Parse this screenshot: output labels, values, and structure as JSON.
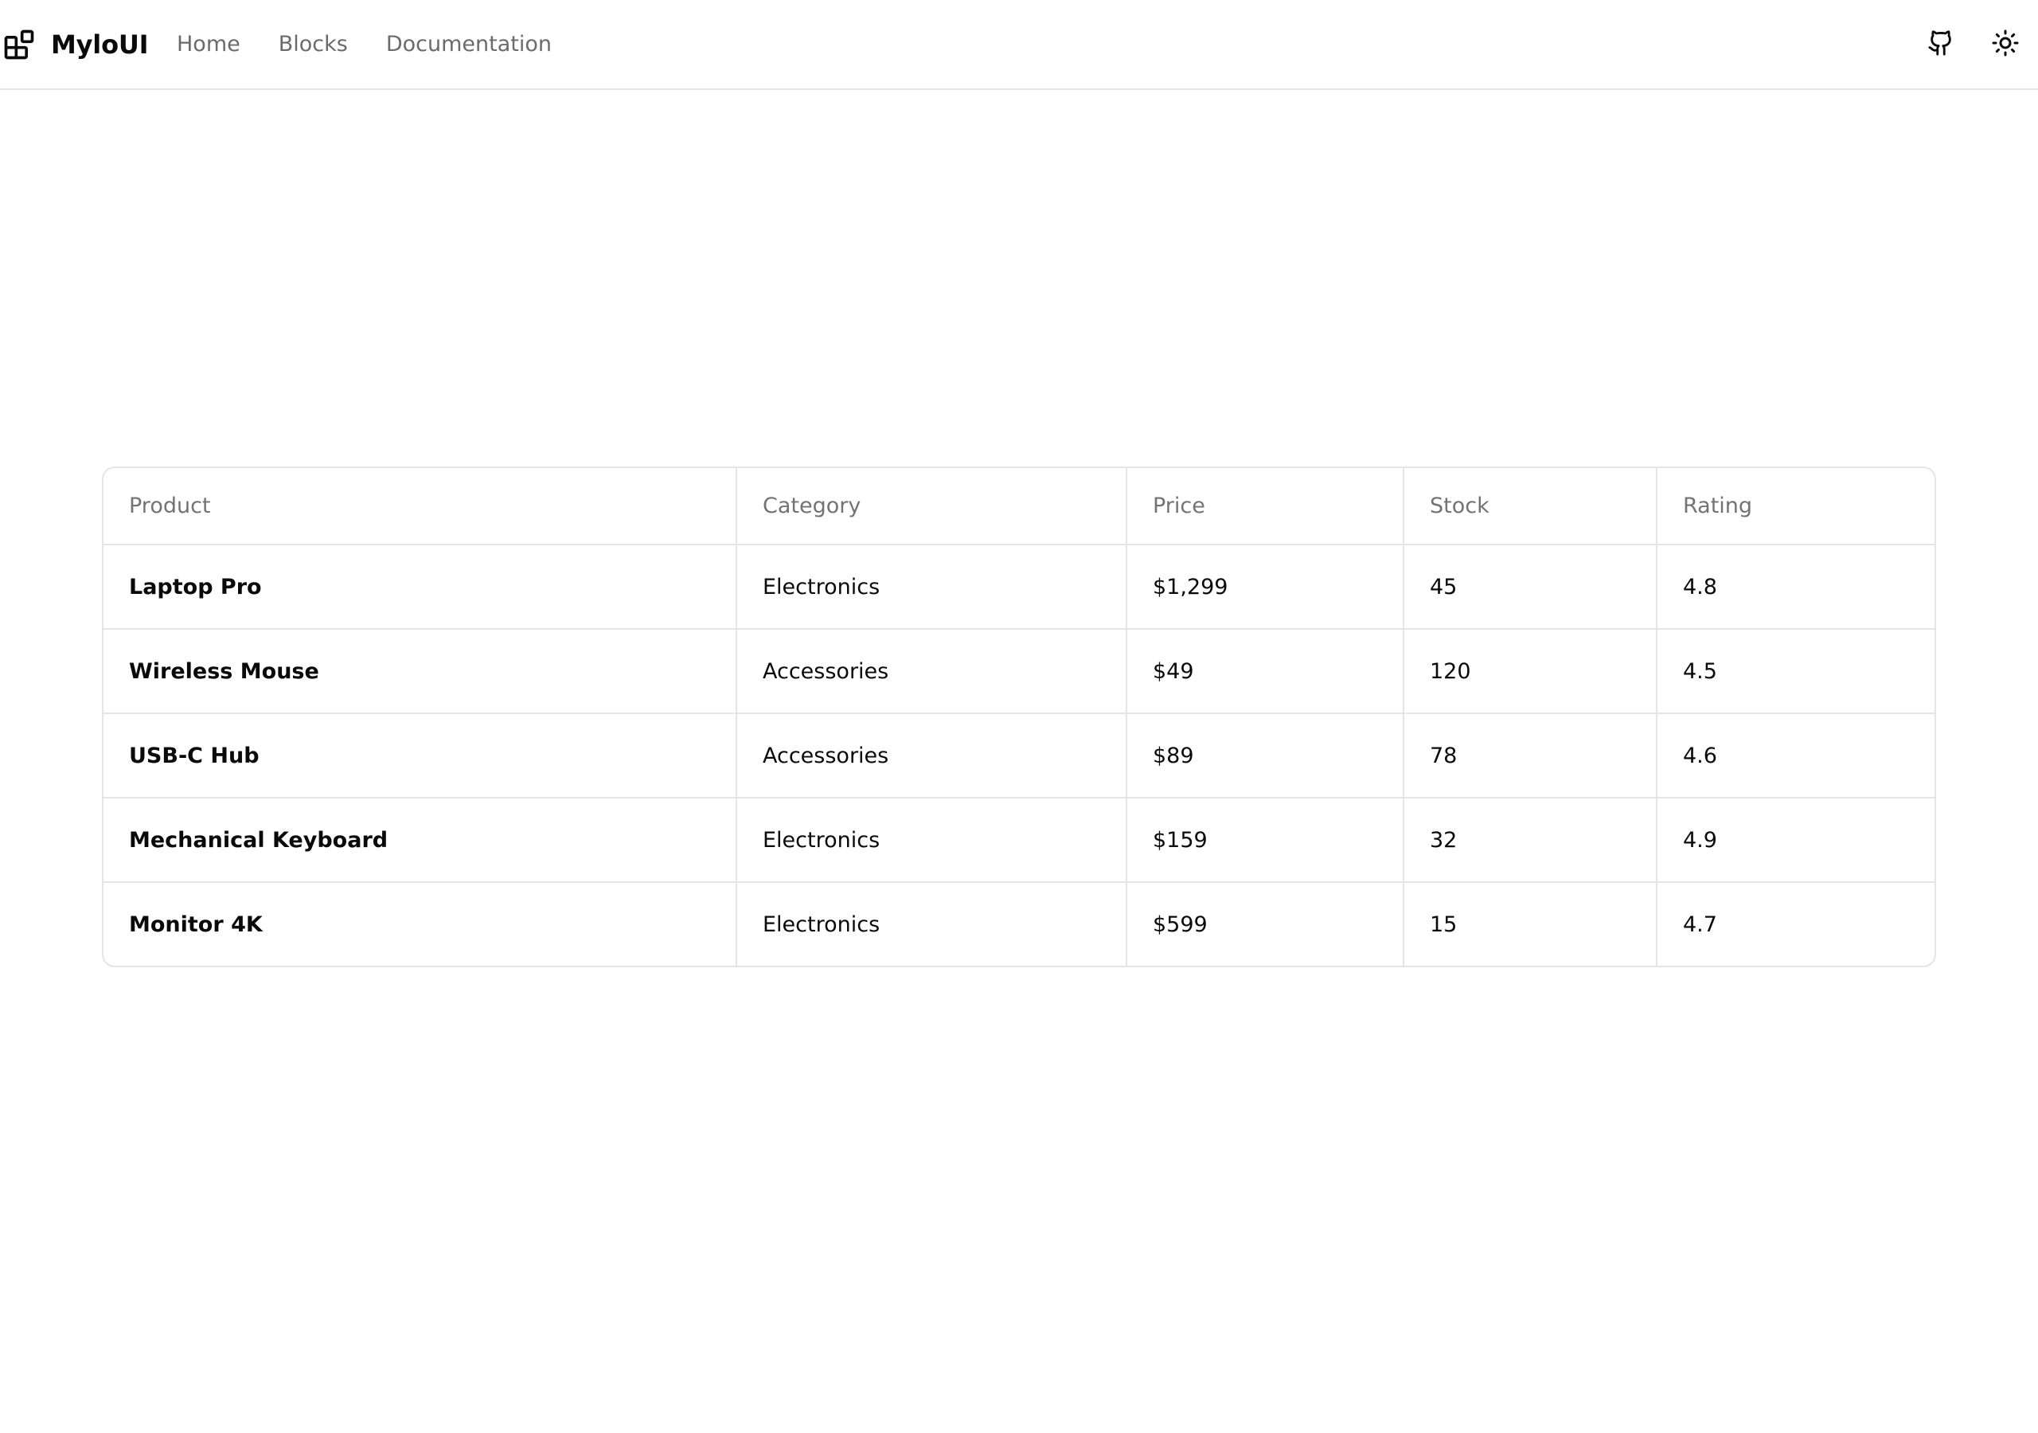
{
  "header": {
    "brand": {
      "name": "MyloUI",
      "icon": "blocks-logo-icon"
    },
    "nav": [
      {
        "label": "Home"
      },
      {
        "label": "Blocks"
      },
      {
        "label": "Documentation"
      }
    ],
    "actions": [
      {
        "icon": "github-icon"
      },
      {
        "icon": "sun-icon"
      }
    ]
  },
  "table": {
    "columns": [
      "Product",
      "Category",
      "Price",
      "Stock",
      "Rating"
    ],
    "rows": [
      {
        "product": "Laptop Pro",
        "category": "Electronics",
        "price": "$1,299",
        "stock": "45",
        "rating": "4.8"
      },
      {
        "product": "Wireless Mouse",
        "category": "Accessories",
        "price": "$49",
        "stock": "120",
        "rating": "4.5"
      },
      {
        "product": "USB-C Hub",
        "category": "Accessories",
        "price": "$89",
        "stock": "78",
        "rating": "4.6"
      },
      {
        "product": "Mechanical Keyboard",
        "category": "Electronics",
        "price": "$159",
        "stock": "32",
        "rating": "4.9"
      },
      {
        "product": "Monitor 4K",
        "category": "Electronics",
        "price": "$599",
        "stock": "15",
        "rating": "4.7"
      }
    ]
  },
  "colors": {
    "text": "#0a0a0a",
    "muted": "#6b6b6b",
    "border": "#e5e5e5",
    "background": "#ffffff"
  }
}
